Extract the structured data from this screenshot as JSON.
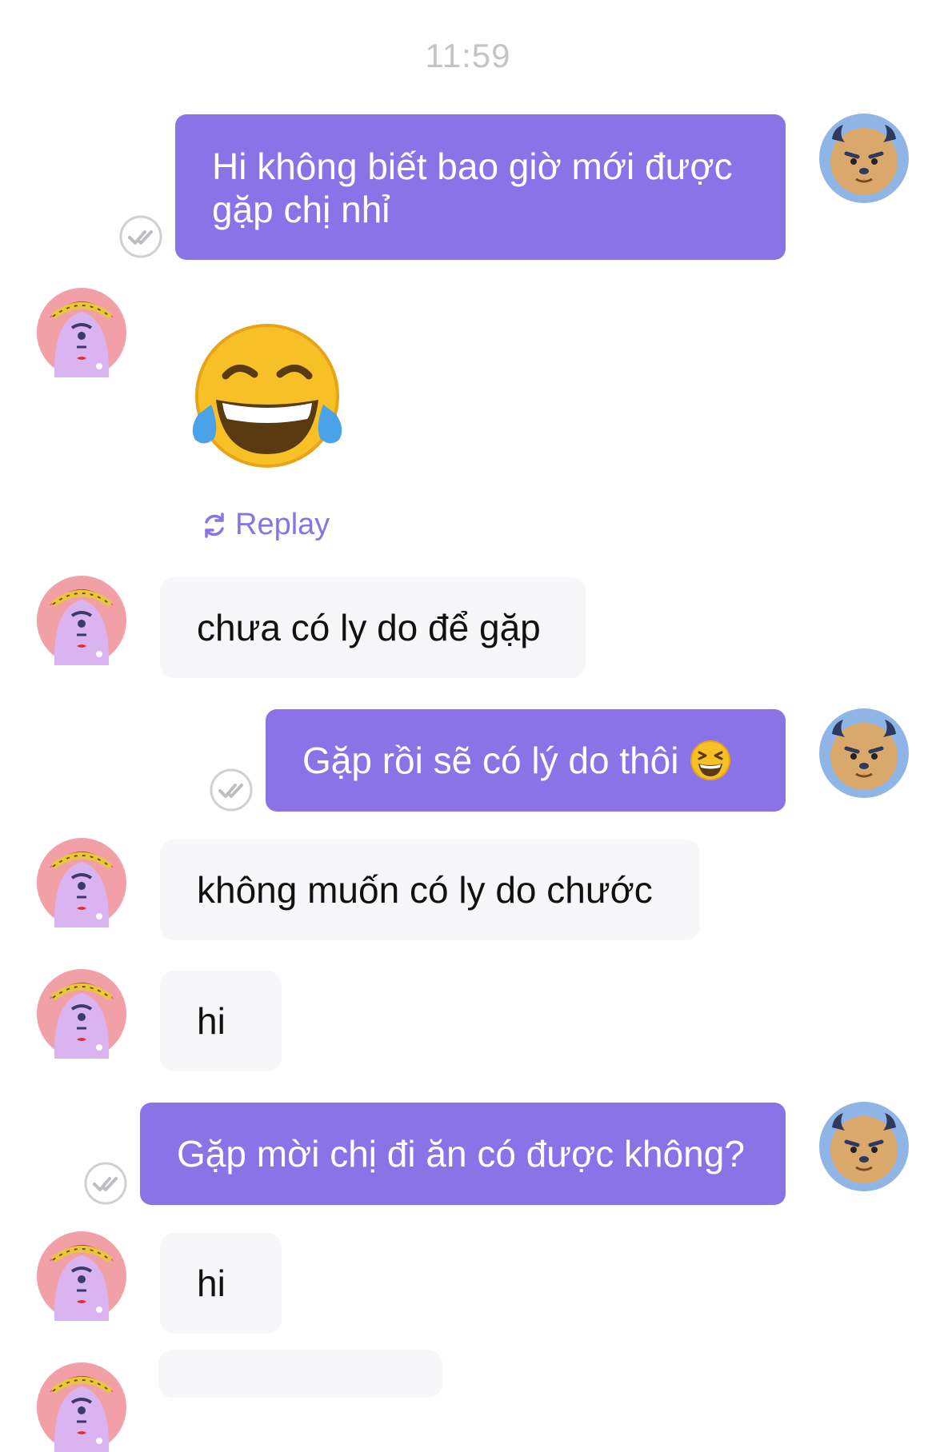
{
  "timestamp": "11:59",
  "messages": [
    {
      "text": "Hi không biết bao giờ mới được gặp chị nhỉ"
    },
    {
      "sticker": "laughing-tears-emoji"
    },
    {
      "text": "chưa có ly do để gặp"
    },
    {
      "text": "Gặp rồi sẽ có lý do thôi"
    },
    {
      "text": "không muốn có ly do chước"
    },
    {
      "text": "hi"
    },
    {
      "text": "Gặp mời chị đi ăn có được không?"
    },
    {
      "text": "hi"
    }
  ],
  "replay_label": "Replay",
  "colors": {
    "outgoing_bubble": "#8a73e6",
    "incoming_bubble": "#f7f7f9",
    "accent": "#8a73e6",
    "timestamp": "#c4c4c8"
  },
  "icons": {
    "self_avatar": "bull-avatar-icon",
    "other_avatar": "pink-monster-avatar-icon",
    "seen": "double-check-icon",
    "replay": "replay-icon"
  }
}
